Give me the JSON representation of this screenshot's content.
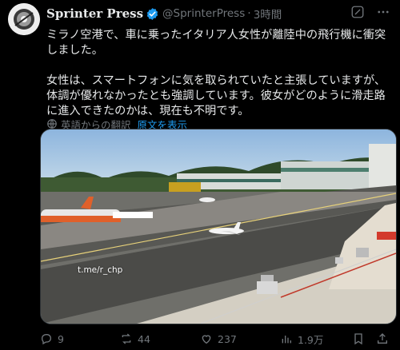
{
  "author": {
    "display_name": "Sprinter Press",
    "handle": "@SprinterPress",
    "separator": "·",
    "time": "3時間"
  },
  "tweet": {
    "paragraph1": "ミラノ空港で、車に乗ったイタリア人女性が離陸中の飛行機に衝突しました。",
    "paragraph2": "女性は、スマートフォンに気を取られていたと主張していますが、体調が優れなかったとも強調しています。彼女がどのように滑走路に進入できたのかは、現在も不明です。"
  },
  "translation": {
    "label": "英語からの翻訳",
    "show_original": "原文を表示"
  },
  "media": {
    "watermark": "t.me/r_chp"
  },
  "actions": {
    "replies": "9",
    "reposts": "44",
    "likes": "237",
    "views": "1.9万"
  },
  "colors": {
    "accent": "#1d9bf0",
    "muted": "#71767b",
    "background": "#000000"
  },
  "icons": [
    "verified-badge-icon",
    "grok-icon",
    "more-icon",
    "globe-icon",
    "reply-icon",
    "repost-icon",
    "like-icon",
    "views-icon",
    "bookmark-icon",
    "share-icon"
  ]
}
